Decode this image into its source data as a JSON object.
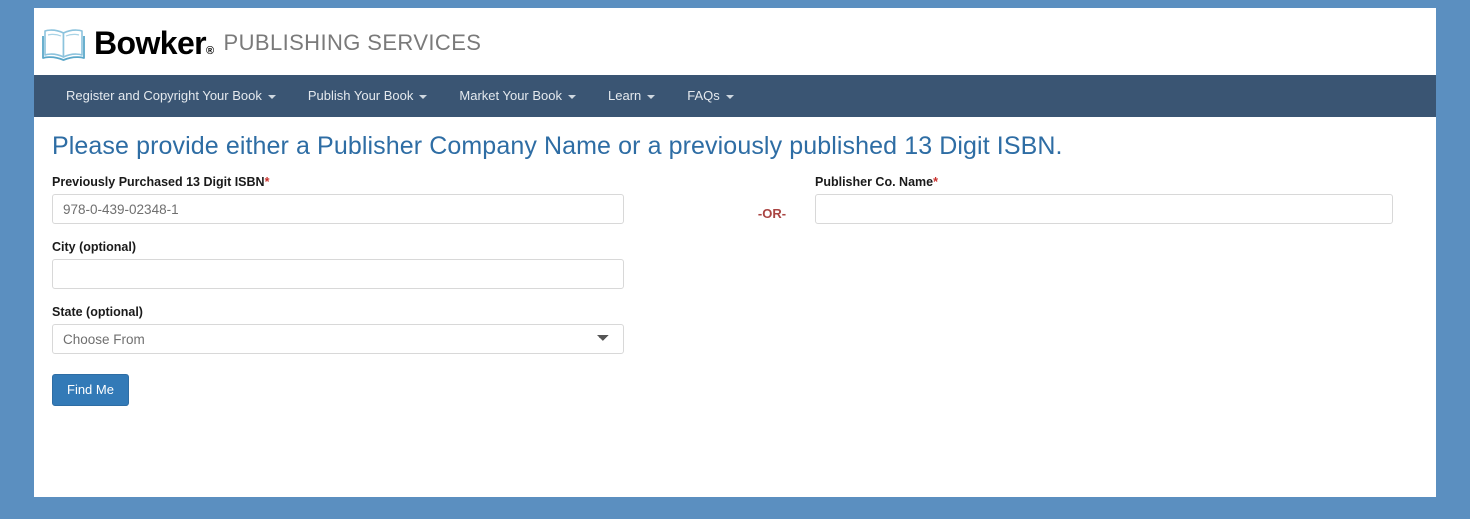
{
  "brand": {
    "logo_icon": "open-book-icon",
    "wordmark": "Bowker",
    "registered_mark": "®",
    "tagline": "PUBLISHING SERVICES"
  },
  "nav": {
    "items": [
      {
        "label": "Register and Copyright Your Book",
        "has_caret": true
      },
      {
        "label": "Publish Your Book",
        "has_caret": true
      },
      {
        "label": "Market Your Book",
        "has_caret": true
      },
      {
        "label": "Learn",
        "has_caret": true
      },
      {
        "label": "FAQs",
        "has_caret": true
      }
    ]
  },
  "main": {
    "title": "Please provide either a Publisher Company Name or a previously published 13 Digit ISBN.",
    "isbn": {
      "label": "Previously Purchased 13 Digit ISBN",
      "required_marker": "*",
      "value": "978-0-439-02348-1",
      "placeholder": "978-0-439-02348-1"
    },
    "or_divider": "-OR-",
    "publisher": {
      "label": "Publisher Co. Name",
      "required_marker": "*",
      "value": "",
      "placeholder": ""
    },
    "city": {
      "label": "City (optional)",
      "value": "",
      "placeholder": ""
    },
    "state": {
      "label": "State (optional)",
      "selected": "Choose From",
      "options": [
        "Choose From"
      ]
    },
    "submit_label": "Find Me"
  },
  "colors": {
    "page_background": "#5b8fc0",
    "navbar": "#3a5573",
    "title": "#2e6da4",
    "required": "#c9302c",
    "or_text": "#a94442",
    "button": "#337ab7"
  }
}
